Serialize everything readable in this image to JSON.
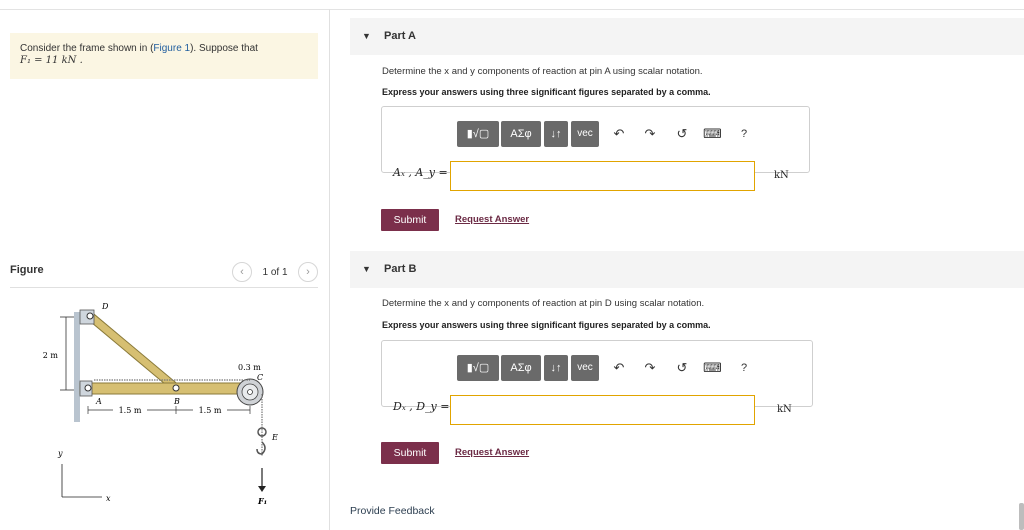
{
  "problem": {
    "text_before": "Consider the frame shown in (",
    "link": "Figure 1",
    "text_after": "). Suppose that",
    "condition": "F₁ = 11  kN ."
  },
  "figure_panel": {
    "title": "Figure",
    "pager": {
      "prev": "‹",
      "next": "›",
      "text": "1 of 1"
    },
    "labels": {
      "D": "D",
      "A": "A",
      "B": "B",
      "C": "C",
      "E": "E",
      "height": "2 m",
      "radius": "0.3 m",
      "seg1": "1.5 m",
      "seg2": "1.5 m",
      "y": "y",
      "x": "x",
      "force": "F₁"
    }
  },
  "part_a": {
    "caret": "▼",
    "title": "Part A",
    "prompt": "Determine the x and y components of reaction at pin A using scalar notation.",
    "instructions": "Express your answers using three significant figures separated by a comma.",
    "answer_label": "Aₓ , A_y =",
    "input_value": "",
    "unit": "kN",
    "submit": "Submit",
    "request": "Request Answer"
  },
  "part_b": {
    "caret": "▼",
    "title": "Part B",
    "prompt": "Determine the x and y components of reaction at pin D using scalar notation.",
    "instructions": "Express your answers using three significant figures separated by a comma.",
    "answer_label": "Dₓ , D_y =",
    "input_value": "",
    "unit": "kN",
    "submit": "Submit",
    "request": "Request Answer"
  },
  "toolbar": {
    "templates": "▮√▢",
    "greek": "ΑΣφ",
    "arrows": "↓↑",
    "vec": "vec",
    "undo": "↶",
    "redo": "↷",
    "reset": "↺",
    "keyboard": "⌨",
    "help": "?"
  },
  "footer": {
    "feedback": "Provide Feedback"
  },
  "colors": {
    "accent": "#7b2f4b",
    "input_border": "#e1a400",
    "problem_bg": "#fbf6e3",
    "link": "#1f5d9e"
  }
}
